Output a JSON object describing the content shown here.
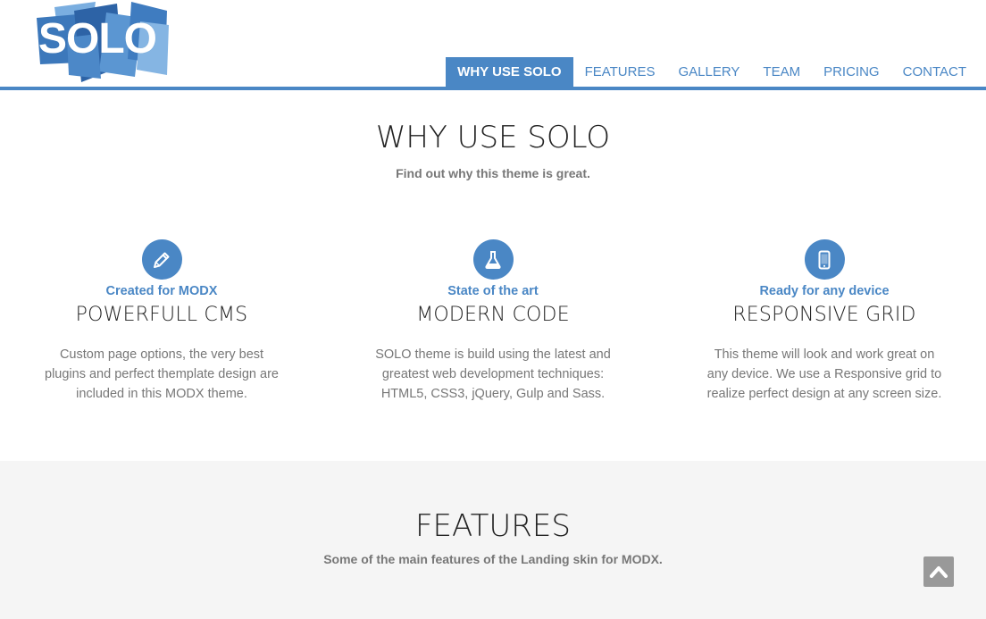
{
  "brand": {
    "logo_text": "SOLO"
  },
  "nav": {
    "items": [
      "WHY USE SOLO",
      "FEATURES",
      "GALLERY",
      "TEAM",
      "PRICING",
      "CONTACT"
    ],
    "active_index": 0
  },
  "why": {
    "title": "WHY USE SOLO",
    "subtitle": "Find out why this theme is great.",
    "columns": [
      {
        "icon": "pencil-icon",
        "kicker": "Created for MODX",
        "title": "POWERFULL CMS",
        "text": "Custom page options, the very best plugins and perfect themplate design are included in this MODX theme."
      },
      {
        "icon": "flask-icon",
        "kicker": "State of the art",
        "title": "MODERN CODE",
        "text": "SOLO theme is build using the latest and greatest web development techniques: HTML5, CSS3, jQuery, Gulp and Sass."
      },
      {
        "icon": "mobile-icon",
        "kicker": "Ready for any device",
        "title": "RESPONSIVE GRID",
        "text": "This theme will look and work great on any device. We use a Responsive grid to realize perfect design at any screen size."
      }
    ]
  },
  "features": {
    "title": "FEATURES",
    "subtitle": "Some of the main features of the Landing skin for MODX."
  },
  "back_to_top": {
    "icon": "chevron-up-icon"
  },
  "colors": {
    "accent": "#4a87c5",
    "muted_text": "#777777",
    "section_bg": "#f5f5f5"
  }
}
